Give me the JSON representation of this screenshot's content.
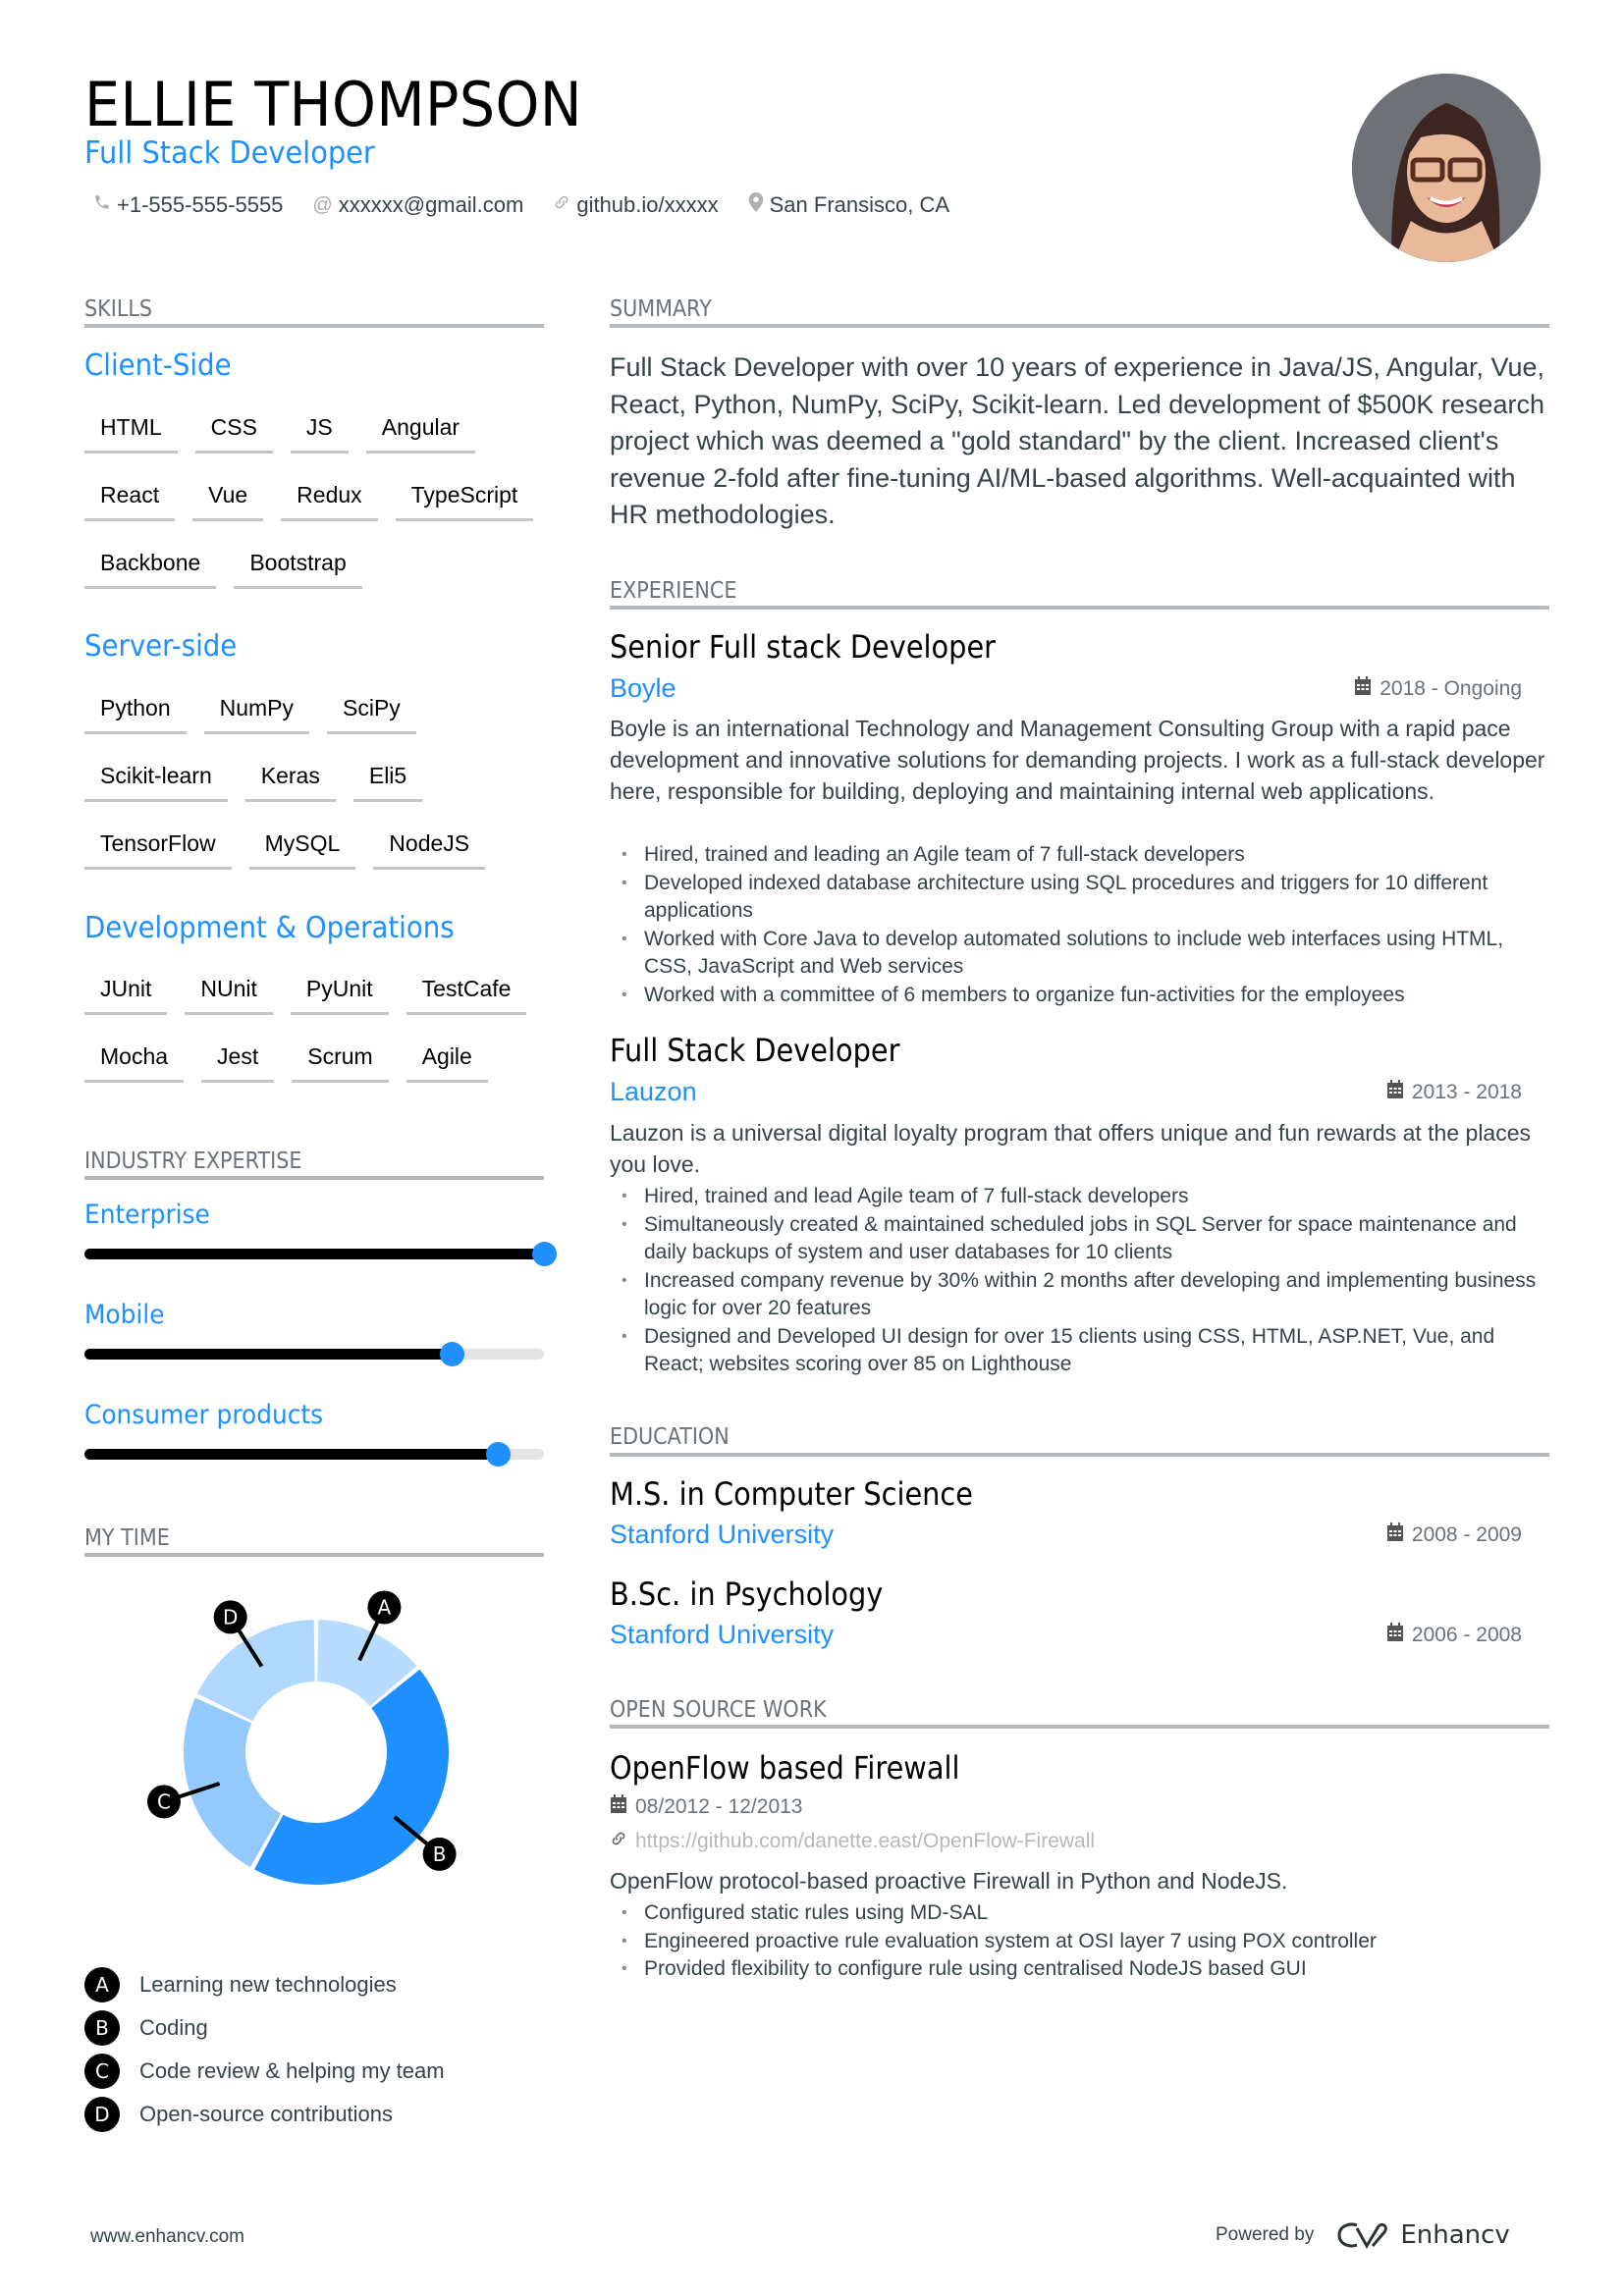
{
  "header": {
    "name": "ELLIE THOMPSON",
    "title": "Full Stack Developer",
    "contacts": [
      {
        "icon": "phone-icon",
        "glyph": "☎",
        "text": "+1-555-555-5555"
      },
      {
        "icon": "at-icon",
        "glyph": "@",
        "text": "xxxxxx@gmail.com"
      },
      {
        "icon": "link-icon",
        "glyph": "⚯",
        "text": "github.io/xxxxx"
      },
      {
        "icon": "location-pin-icon",
        "glyph": "⌖",
        "text": "San Fransisco, CA"
      }
    ]
  },
  "skills": {
    "heading": "SKILLS",
    "groups": [
      {
        "title": "Client-Side",
        "rows": [
          [
            "HTML",
            "CSS",
            "JS",
            "Angular"
          ],
          [
            "React",
            "Vue",
            "Redux",
            "TypeScript"
          ],
          [
            "Backbone",
            "Bootstrap"
          ]
        ]
      },
      {
        "title": "Server-side",
        "rows": [
          [
            "Python",
            "NumPy",
            "SciPy"
          ],
          [
            "Scikit-learn",
            "Keras",
            "Eli5"
          ],
          [
            "TensorFlow",
            "MySQL",
            "NodeJS"
          ]
        ]
      },
      {
        "title": "Development & Operations",
        "rows": [
          [
            "JUnit",
            "NUnit",
            "PyUnit",
            "TestCafe"
          ],
          [
            "Mocha",
            "Jest",
            "Scrum",
            "Agile"
          ]
        ]
      }
    ]
  },
  "industry": {
    "heading": "INDUSTRY EXPERTISE",
    "items": [
      {
        "label": "Enterprise",
        "level": 1.0
      },
      {
        "label": "Mobile",
        "level": 0.8
      },
      {
        "label": "Consumer products",
        "level": 0.9
      }
    ],
    "fill_color": "#000000",
    "knob_color": "#1e90ff"
  },
  "my_time": {
    "heading": "MY TIME",
    "legend": [
      {
        "badge": "A",
        "label": "Learning new technologies"
      },
      {
        "badge": "B",
        "label": "Coding"
      },
      {
        "badge": "C",
        "label": "Code review & helping my team"
      },
      {
        "badge": "D",
        "label": "Open-source contributions"
      }
    ]
  },
  "chart_data": {
    "type": "pie",
    "variant": "donut",
    "title": "MY TIME",
    "categories": [
      "A",
      "B",
      "C",
      "D"
    ],
    "labels": [
      "Learning new technologies",
      "Coding",
      "Code review & helping my team",
      "Open-source contributions"
    ],
    "values": [
      14,
      44,
      24,
      18
    ],
    "colors": [
      "#b7dcfd",
      "#1e90ff",
      "#94c9fd",
      "#b0d7fd"
    ],
    "start": "top",
    "direction": "clockwise"
  },
  "summary": {
    "heading": "SUMMARY",
    "text": "Full Stack Developer with over 10 years of experience in Java/JS, Angular, Vue, React, Python, NumPy, SciPy, Scikit-learn. Led development of $500K research project which was deemed a \"gold standard\" by the client. Increased client's revenue 2-fold after fine-tuning AI/ML-based algorithms. Well-acquainted with HR methodologies."
  },
  "experience": {
    "heading": "EXPERIENCE",
    "jobs": [
      {
        "role": "Senior Full stack Developer",
        "company": "Boyle",
        "dates": "2018 - Ongoing",
        "description": "Boyle is an international Technology and Management Consulting Group with a rapid pace development and innovative solutions for demanding projects. I work as a full-stack developer here, responsible for building, deploying and maintaining internal web applications.",
        "bullets": [
          "Hired, trained and leading an Agile team of 7 full-stack developers",
          "Developed indexed database architecture using SQL procedures and triggers for 10 different applications",
          "Worked with Core Java to develop automated solutions to include web interfaces using HTML, CSS, JavaScript and Web services",
          "Worked with a committee of 6 members to organize fun-activities for the employees"
        ]
      },
      {
        "role": "Full Stack Developer",
        "company": "Lauzon",
        "dates": "2013 - 2018",
        "description": "Lauzon is a universal digital loyalty program that offers unique and fun rewards at the places you love.",
        "bullets": [
          "Hired, trained and lead Agile team of 7 full-stack developers",
          "Simultaneously created & maintained scheduled jobs in SQL Server for space maintenance and daily backups of system and user databases for 10 clients",
          "Increased company revenue by 30% within 2 months after developing and implementing business logic for over 20 features",
          "Designed and Developed UI design for over 15 clients using CSS, HTML, ASP.NET, Vue, and React; websites scoring over 85 on Lighthouse"
        ]
      }
    ]
  },
  "education": {
    "heading": "EDUCATION",
    "items": [
      {
        "degree": "M.S. in Computer Science",
        "school": "Stanford University",
        "dates": "2008 - 2009"
      },
      {
        "degree": "B.Sc. in Psychology",
        "school": "Stanford University",
        "dates": "2006 - 2008"
      }
    ]
  },
  "open_source": {
    "heading": "OPEN SOURCE WORK",
    "project": {
      "title": "OpenFlow based Firewall",
      "dates": "08/2012 - 12/2013",
      "link": "https://github.com/danette.east/OpenFlow-Firewall",
      "description": "OpenFlow protocol-based proactive Firewall in Python and NodeJS.",
      "bullets": [
        "Configured static rules using MD-SAL",
        "Engineered proactive rule evaluation system at OSI layer 7 using POX controller",
        "Provided flexibility to configure rule using centralised NodeJS based GUI"
      ]
    }
  },
  "footer": {
    "website": "www.enhancv.com",
    "powered_by": "Powered by",
    "brand": "Enhancv"
  },
  "icons": {
    "calendar": "▦",
    "link": "⚯"
  }
}
